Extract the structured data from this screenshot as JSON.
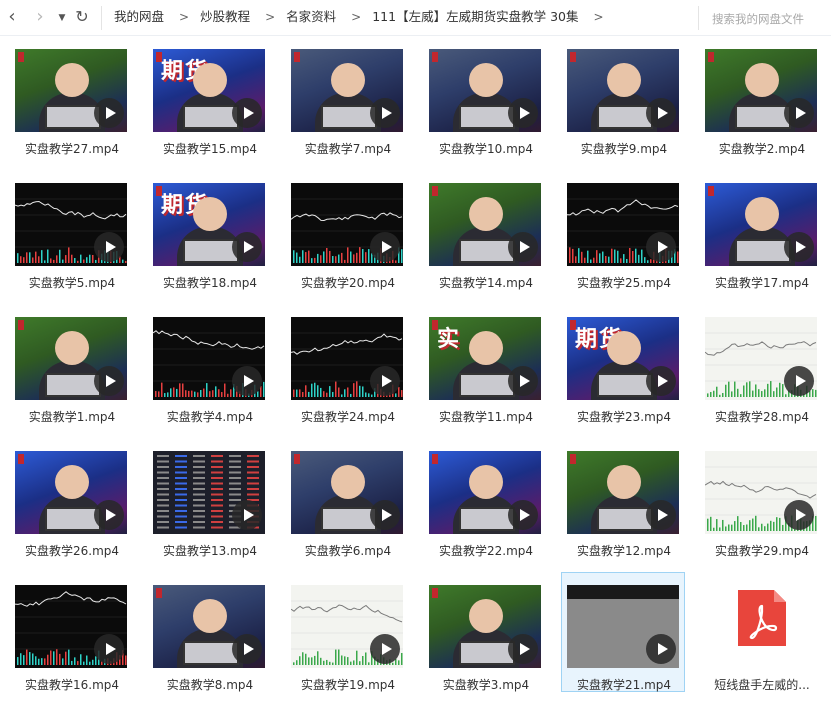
{
  "nav": {
    "back": "‹",
    "forward": "›",
    "dropdown": "▼",
    "refresh": "↻"
  },
  "breadcrumb": [
    "我的网盘",
    "炒股教程",
    "名家资料",
    "111【左威】左威期货实盘教学 30集"
  ],
  "breadcrumb_sep": ">",
  "search": {
    "placeholder": "搜索我的网盘文件"
  },
  "colors": {
    "selection_bg": "#e8f4fd",
    "selection_border": "#9fd3f4",
    "pdf_red": "#e8453c"
  },
  "files": [
    {
      "name": "实盘教学27.mp4",
      "thumb": "green",
      "icon": "play-icon"
    },
    {
      "name": "实盘教学15.mp4",
      "thumb": "studio",
      "banner": "期货",
      "icon": "play-icon"
    },
    {
      "name": "实盘教学7.mp4",
      "thumb": "room",
      "icon": "play-icon"
    },
    {
      "name": "实盘教学10.mp4",
      "thumb": "room",
      "icon": "play-icon"
    },
    {
      "name": "实盘教学9.mp4",
      "thumb": "room",
      "icon": "play-icon"
    },
    {
      "name": "实盘教学2.mp4",
      "thumb": "green",
      "icon": "play-icon"
    },
    {
      "name": "实盘教学5.mp4",
      "thumb": "chart",
      "icon": "play-icon"
    },
    {
      "name": "实盘教学18.mp4",
      "thumb": "studio",
      "banner": "期货",
      "icon": "play-icon"
    },
    {
      "name": "实盘教学20.mp4",
      "thumb": "chart",
      "icon": "play-icon"
    },
    {
      "name": "实盘教学14.mp4",
      "thumb": "green",
      "icon": "play-icon"
    },
    {
      "name": "实盘教学25.mp4",
      "thumb": "chart",
      "icon": "play-icon"
    },
    {
      "name": "实盘教学17.mp4",
      "thumb": "studio",
      "icon": "play-icon"
    },
    {
      "name": "实盘教学1.mp4",
      "thumb": "green",
      "icon": "play-icon"
    },
    {
      "name": "实盘教学4.mp4",
      "thumb": "chart",
      "icon": "play-icon"
    },
    {
      "name": "实盘教学24.mp4",
      "thumb": "chart",
      "icon": "play-icon"
    },
    {
      "name": "实盘教学11.mp4",
      "thumb": "green",
      "banner": "实",
      "icon": "play-icon"
    },
    {
      "name": "实盘教学23.mp4",
      "thumb": "studio",
      "banner": "期货",
      "icon": "play-icon"
    },
    {
      "name": "实盘教学28.mp4",
      "thumb": "lightchart",
      "icon": "play-icon"
    },
    {
      "name": "实盘教学26.mp4",
      "thumb": "studio",
      "icon": "play-icon"
    },
    {
      "name": "实盘教学13.mp4",
      "thumb": "table",
      "icon": "play-icon"
    },
    {
      "name": "实盘教学6.mp4",
      "thumb": "room",
      "icon": "play-icon"
    },
    {
      "name": "实盘教学22.mp4",
      "thumb": "studio",
      "icon": "play-icon"
    },
    {
      "name": "实盘教学12.mp4",
      "thumb": "green",
      "icon": "play-icon"
    },
    {
      "name": "实盘教学29.mp4",
      "thumb": "lightchart",
      "icon": "play-icon"
    },
    {
      "name": "实盘教学16.mp4",
      "thumb": "chart",
      "icon": "play-icon"
    },
    {
      "name": "实盘教学8.mp4",
      "thumb": "room",
      "icon": "play-icon"
    },
    {
      "name": "实盘教学19.mp4",
      "thumb": "lightchart",
      "icon": "play-icon"
    },
    {
      "name": "实盘教学3.mp4",
      "thumb": "green",
      "icon": "play-icon"
    },
    {
      "name": "实盘教学21.mp4",
      "thumb": "gray",
      "icon": "play-icon",
      "selected": true
    },
    {
      "name": "短线盘手左威的...",
      "thumb": "pdf",
      "icon": "pdf-icon"
    }
  ]
}
